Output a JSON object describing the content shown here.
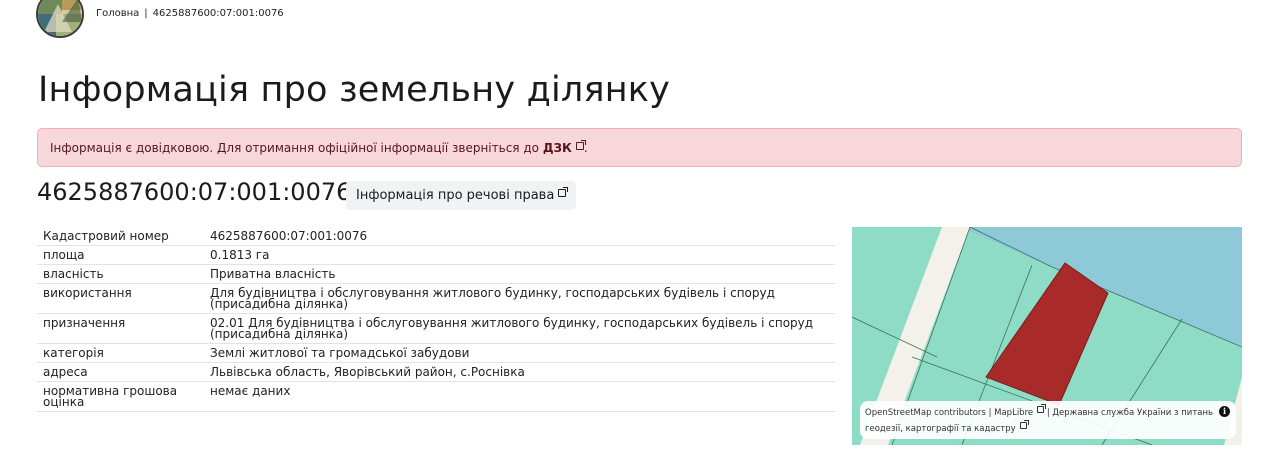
{
  "breadcrumb": {
    "home": "Головна",
    "separator": "|",
    "current": "4625887600:07:001:0076"
  },
  "page_title": "Інформація про земельну ділянку",
  "alert": {
    "text": "Інформація є довідковою. Для отримання офіційної інформації зверніться до",
    "link": "ДЗК",
    "suffix": "."
  },
  "parcel": {
    "cadastral_title": "4625887600:07:001:0076",
    "rights_button": "Інформація про речові права"
  },
  "details": [
    {
      "key": "Кадастровий номер",
      "value": "4625887600:07:001:0076"
    },
    {
      "key": "площа",
      "value": "0.1813 га"
    },
    {
      "key": "власність",
      "value": "Приватна власність"
    },
    {
      "key": "використання",
      "value": "Для будівництва і обслуговування житлового будинку, господарських будівель і споруд (присадибна ділянка)"
    },
    {
      "key": "призначення",
      "value": "02.01 Для будівництва і обслуговування житлового будинку, господарських будівель і споруд (присадибна ділянка)"
    },
    {
      "key": "категорія",
      "value": "Землі житлової та громадської забудови"
    },
    {
      "key": "адреса",
      "value": "Львівська область, Яворівський район, с.Роснівка"
    },
    {
      "key": "нормативна грошова оцінка",
      "value": "немає даних"
    }
  ],
  "map": {
    "attribution": {
      "osm": "OpenStreetMap contributors",
      "sep": "|",
      "maplibre": "MapLibre",
      "sep2": "|",
      "agency": "Державна служба України з питань геодезії, картографії та кадастру"
    },
    "info_icon": "i",
    "colors": {
      "parcel": "#a82a29",
      "land": "#8fdcc6",
      "water": "#8ec9d8",
      "road": "#f3f1ea"
    }
  },
  "icons": {
    "external_link": "external-link-icon",
    "logo": "logo-icon"
  }
}
